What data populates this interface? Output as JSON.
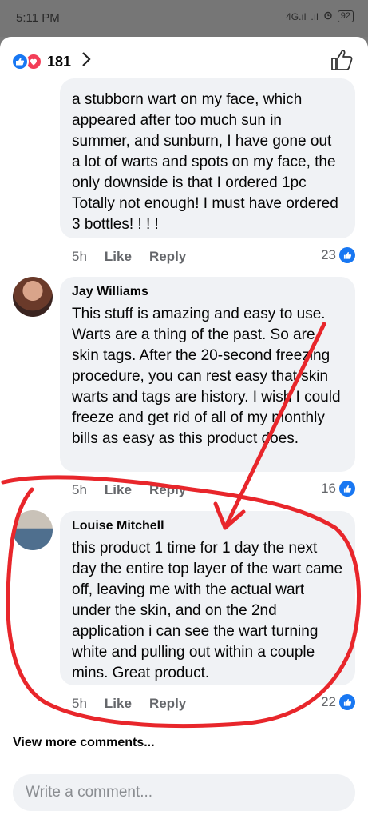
{
  "status_bar": {
    "time": "5:11 PM",
    "signal_1": "4G.ıl",
    "signal_2": ".ıl",
    "battery": "92"
  },
  "header": {
    "reaction_count": "181",
    "icons": [
      "like-reaction-icon",
      "love-reaction-icon",
      "chevron-right-icon",
      "thumbs-up-outline-icon"
    ]
  },
  "comments": [
    {
      "author": "",
      "text": "a stubborn wart on my face, which appeared after too much sun in summer, and sunburn, I have gone out a lot of warts and spots on my face, the only downside is that I ordered 1pc Totally not enough! I must have ordered 3 bottles! ! ! !",
      "time": "5h",
      "like_label": "Like",
      "reply_label": "Reply",
      "likes": "23"
    },
    {
      "author": "Jay Williams",
      "text": "This stuff is amazing and easy to use. Warts are a thing of the past. So are skin tags. After the 20-second freezing procedure, you can rest easy that skin warts and tags are history. I wish I could freeze and get rid of all of my monthly bills as easy as this product does.",
      "time": "5h",
      "like_label": "Like",
      "reply_label": "Reply",
      "likes": "16"
    },
    {
      "author": "Louise Mitchell",
      "text": "this product 1 time for 1 day the next day the entire top layer of the wart came off, leaving me with the actual wart under the skin, and on the 2nd application i can see the wart turning white and pulling out within a couple mins. Great product.",
      "time": "5h",
      "like_label": "Like",
      "reply_label": "Reply",
      "likes": "22"
    }
  ],
  "view_more": "View more comments...",
  "composer": {
    "placeholder": "Write a comment..."
  },
  "colors": {
    "accent": "#1877f2",
    "love": "#f33e58",
    "annotation": "#e8262b",
    "bubble": "#f0f2f5"
  }
}
